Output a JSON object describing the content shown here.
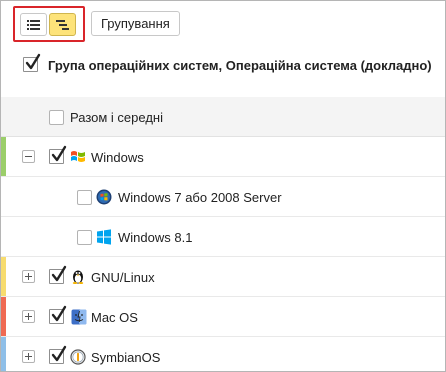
{
  "toolbar": {
    "list_view_icon": "list-icon",
    "tree_view_icon": "tree-icon",
    "grouping_label": "Групування"
  },
  "header": {
    "checked": true,
    "text": "Група операційних систем, Операційна система (докладно)"
  },
  "summary": {
    "checked": false,
    "label": "Разом і середні"
  },
  "rows": [
    {
      "label": "Windows",
      "toggle": "minus",
      "checked": true,
      "icon": "windows-xp-logo-icon",
      "stripe": "#9bce6a"
    },
    {
      "label": "Windows 7 або 2008 Server",
      "checked": false,
      "icon": "windows-7-logo-icon"
    },
    {
      "label": "Windows 8.1",
      "checked": false,
      "icon": "windows-8-logo-icon"
    },
    {
      "label": "GNU/Linux",
      "toggle": "plus",
      "checked": true,
      "icon": "tux-penguin-icon",
      "stripe": "#f7dc6f"
    },
    {
      "label": "Mac OS",
      "toggle": "plus",
      "checked": true,
      "icon": "apple-finder-icon",
      "stripe": "#ef6a53"
    },
    {
      "label": "SymbianOS",
      "toggle": "plus",
      "checked": true,
      "icon": "symbian-logo-icon",
      "stripe": "#8fbfe8"
    }
  ]
}
